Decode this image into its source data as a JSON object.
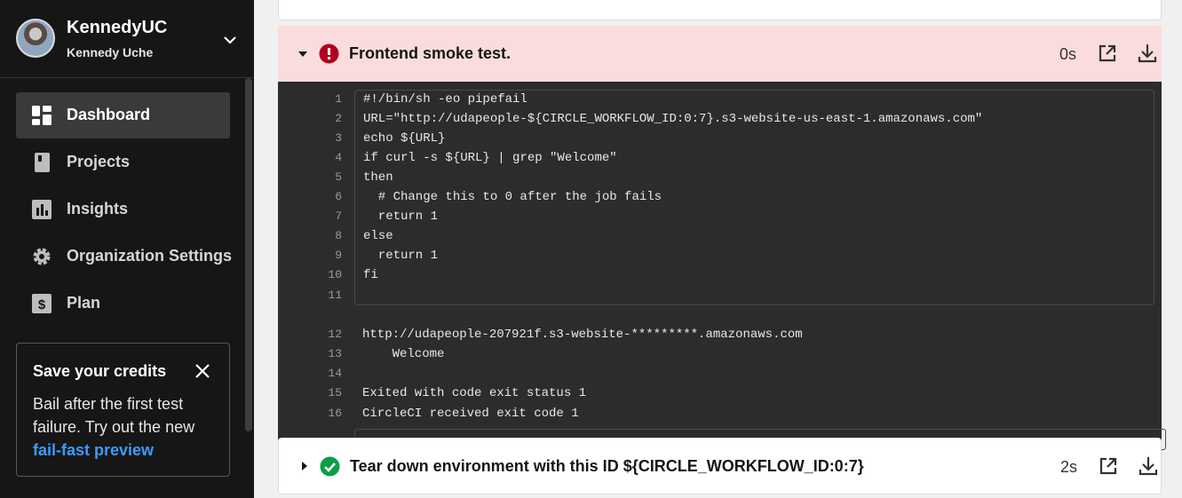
{
  "sidebar": {
    "org_name": "KennedyUC",
    "user_name": "Kennedy Uche",
    "nav": [
      {
        "label": "Dashboard",
        "icon": "dashboard-icon"
      },
      {
        "label": "Projects",
        "icon": "book-icon"
      },
      {
        "label": "Insights",
        "icon": "chart-icon"
      },
      {
        "label": "Organization Settings",
        "icon": "gear-icon"
      },
      {
        "label": "Plan",
        "icon": "dollar-icon"
      }
    ],
    "credits": {
      "title": "Save your credits",
      "body": "Bail after the first test failure. Try out the new",
      "link": "fail-fast preview"
    }
  },
  "steps": {
    "failed": {
      "title": "Frontend smoke test.",
      "duration": "0s",
      "status_color": "#b00020",
      "lines": [
        {
          "n": "1",
          "text": "#!/bin/sh -eo pipefail"
        },
        {
          "n": "2",
          "text": "URL=\"http://udapeople-${CIRCLE_WORKFLOW_ID:0:7}.s3-website-us-east-1.amazonaws.com\""
        },
        {
          "n": "3",
          "text": "echo ${URL}"
        },
        {
          "n": "4",
          "text": "if curl -s ${URL} | grep \"Welcome\""
        },
        {
          "n": "5",
          "text": "then"
        },
        {
          "n": "6",
          "text": "  # Change this to 0 after the job fails"
        },
        {
          "n": "7",
          "text": "  return 1"
        },
        {
          "n": "8",
          "text": "else"
        },
        {
          "n": "9",
          "text": "  return 1"
        },
        {
          "n": "10",
          "text": "fi"
        },
        {
          "n": "11",
          "text": ""
        },
        {
          "n": "12",
          "text": "http://udapeople-207921f.s3-website-*********.amazonaws.com"
        },
        {
          "n": "13",
          "text": "    Welcome"
        },
        {
          "n": "14",
          "text": ""
        },
        {
          "n": "15",
          "text": "Exited with code exit status 1"
        },
        {
          "n": "16",
          "text": "CircleCI received exit code 1"
        }
      ]
    },
    "next": {
      "title": "Tear down environment with this ID ${CIRCLE_WORKFLOW_ID:0:7}",
      "duration": "2s",
      "status_color": "#0a9e47"
    }
  }
}
